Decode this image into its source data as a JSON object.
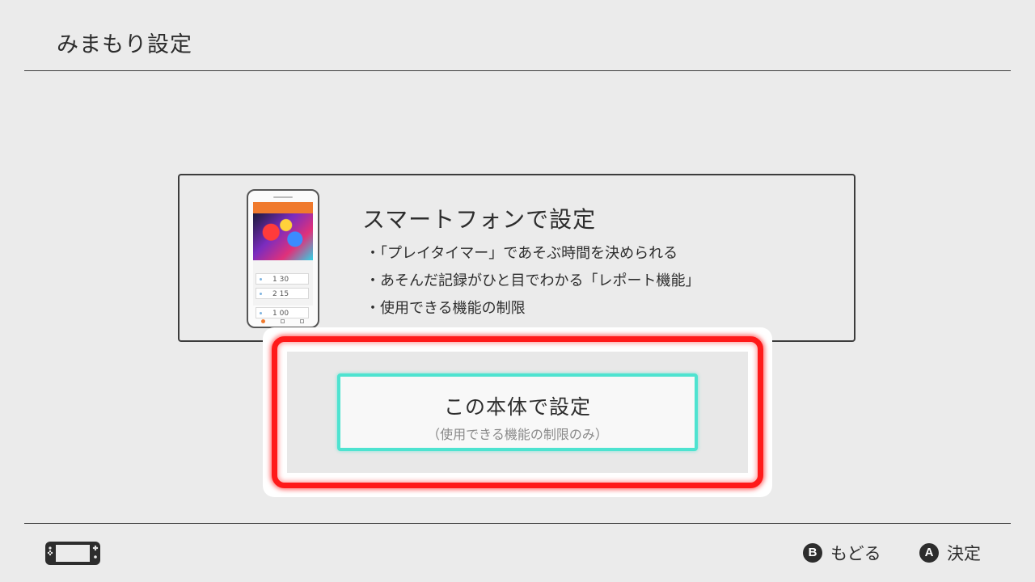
{
  "header": {
    "title": "みまもり設定"
  },
  "smartphone_option": {
    "title": "スマートフォンで設定",
    "bullets": [
      "・「プレイタイマー」であそぶ時間を決められる",
      "・あそんだ記録がひと目でわかる「レポート機能」",
      "・使用できる機能の制限"
    ],
    "phone_rows": [
      "1 30",
      "2 15",
      "1 00"
    ]
  },
  "device_option": {
    "title": "この本体で設定",
    "subtitle": "（使用できる機能の制限のみ）"
  },
  "footer": {
    "back": {
      "glyph": "B",
      "label": "もどる"
    },
    "confirm": {
      "glyph": "A",
      "label": "決定"
    }
  },
  "colors": {
    "background": "#ebebeb",
    "focus_outline": "#ff1a1a",
    "selection_cyan": "#4ee3d0",
    "phone_accent": "#f07a2d"
  },
  "icons": {
    "console": "handheld-console-icon"
  }
}
